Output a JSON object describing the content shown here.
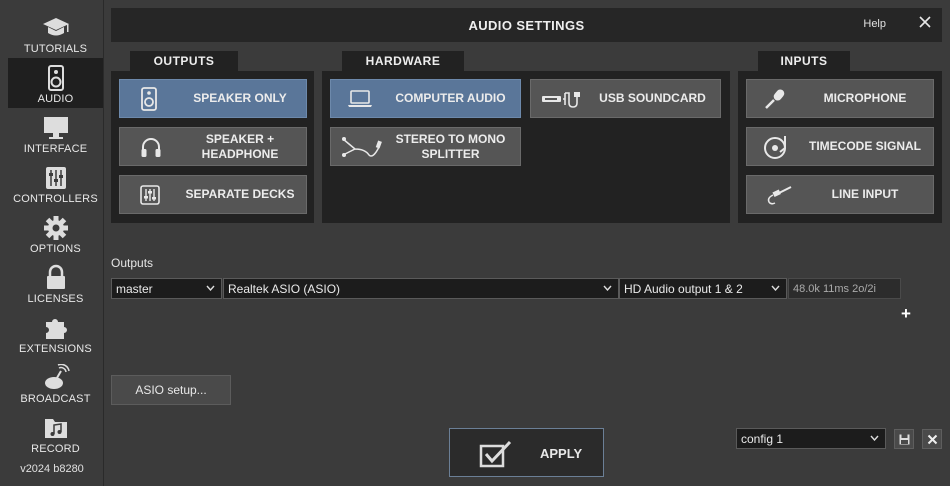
{
  "header": {
    "title": "AUDIO SETTINGS",
    "help": "Help",
    "close_icon": "close-icon"
  },
  "sidebar": {
    "items": [
      {
        "label": "TUTORIALS",
        "icon": "graduation-cap-icon"
      },
      {
        "label": "AUDIO",
        "icon": "speaker-icon",
        "active": true
      },
      {
        "label": "INTERFACE",
        "icon": "monitor-icon"
      },
      {
        "label": "CONTROLLERS",
        "icon": "sliders-icon"
      },
      {
        "label": "OPTIONS",
        "icon": "gear-icon"
      },
      {
        "label": "LICENSES",
        "icon": "lock-icon"
      },
      {
        "label": "EXTENSIONS",
        "icon": "puzzle-icon"
      },
      {
        "label": "BROADCAST",
        "icon": "broadcast-icon"
      },
      {
        "label": "RECORD",
        "icon": "music-folder-icon"
      }
    ],
    "version": "v2024 b8280"
  },
  "outputs_panel": {
    "tab": "OUTPUTS",
    "buttons": [
      {
        "label": "SPEAKER ONLY",
        "icon": "speaker-icon",
        "selected": true
      },
      {
        "label": "SPEAKER +\nHEADPHONE",
        "icon": "headphones-icon",
        "selected": false
      },
      {
        "label": "SEPARATE DECKS",
        "icon": "mixer-icon",
        "selected": false
      }
    ]
  },
  "hardware_panel": {
    "tab": "HARDWARE",
    "buttons": [
      {
        "label": "COMPUTER AUDIO",
        "icon": "laptop-icon",
        "selected": true
      },
      {
        "label": "USB SOUNDCARD",
        "icon": "usb-icon",
        "selected": false
      },
      {
        "label": "STEREO TO MONO\nSPLITTER",
        "icon": "splitter-cable-icon",
        "selected": false
      }
    ]
  },
  "inputs_panel": {
    "tab": "INPUTS",
    "buttons": [
      {
        "label": "MICROPHONE",
        "icon": "microphone-icon"
      },
      {
        "label": "TIMECODE SIGNAL",
        "icon": "turntable-icon"
      },
      {
        "label": "LINE INPUT",
        "icon": "line-cable-icon"
      }
    ]
  },
  "routing": {
    "label": "Outputs",
    "channel": "master",
    "device": "Realtek ASIO (ASIO)",
    "output": "HD Audio output 1 & 2",
    "info": "48.0k 11ms 2o/2i",
    "add": "+"
  },
  "asio_button": "ASIO setup...",
  "apply_button": "APPLY",
  "config": {
    "value": "config 1"
  },
  "colors": {
    "selected": "#5a7699",
    "panel": "#222222",
    "button": "#555555",
    "bg": "#3b3b3b"
  }
}
